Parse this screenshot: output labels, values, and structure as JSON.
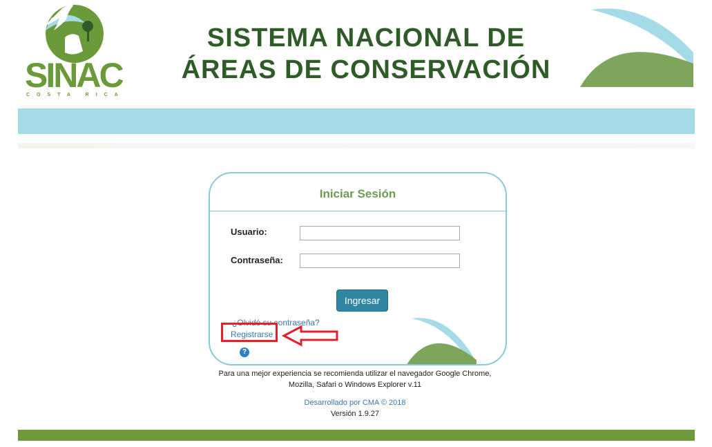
{
  "header": {
    "logo_text": "SINAC",
    "logo_subtext": "COSTA RICA",
    "title_line1": "SISTEMA NACIONAL DE",
    "title_line2": "ÁREAS DE CONSERVACIÓN"
  },
  "login": {
    "title": "Iniciar Sesión",
    "user_label": "Usuario:",
    "user_value": "",
    "password_label": "Contraseña:",
    "password_value": "",
    "submit_label": "Ingresar",
    "forgot_link": "¿Olvidó su contraseña?",
    "register_link": "Registrarse",
    "help_glyph": "?"
  },
  "footer": {
    "browser_note": "Para una mejor experiencia se recomienda utilizar el navegador Google Chrome, Mozilla, Safari o Windows Explorer v.11",
    "credit": "Desarrollado por CMA © 2018",
    "version": "Versión 1.9.27"
  },
  "colors": {
    "brand_green": "#6a9a3a",
    "title_green": "#2f5b28",
    "light_blue": "#a4dbe7",
    "button_blue": "#2f85a2",
    "link_blue": "#3a78a8",
    "annotation_red": "#e3202a"
  },
  "icons": {
    "logo": "sinac-logo",
    "help": "help-icon",
    "arrow": "arrow-left-icon"
  }
}
